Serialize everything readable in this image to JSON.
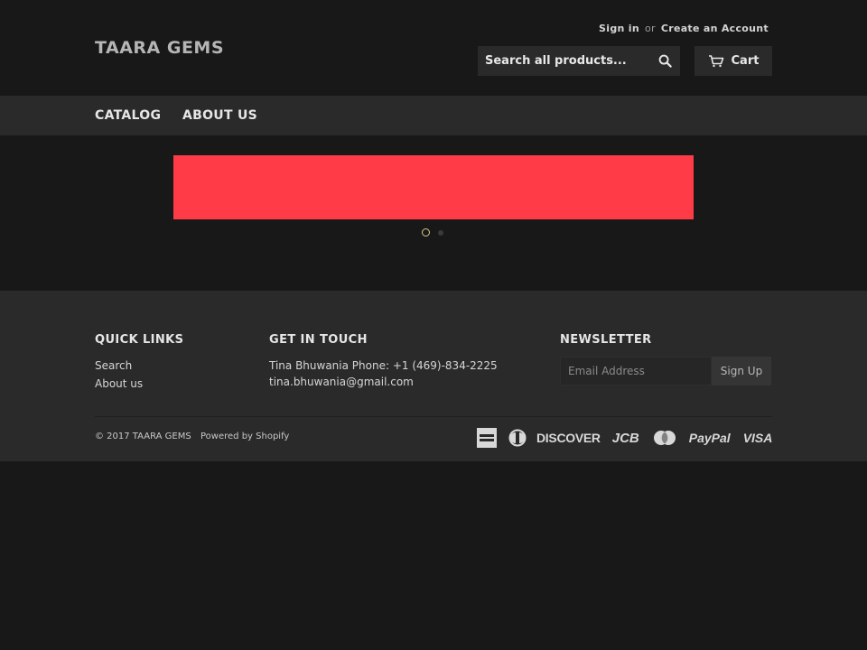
{
  "header": {
    "logo": "TAARA GEMS",
    "sign_in": "Sign in",
    "or": "or",
    "create_account": "Create an Account",
    "search_placeholder": "Search all products...",
    "cart_label": "Cart"
  },
  "nav": {
    "items": [
      {
        "label": "CATALOG"
      },
      {
        "label": "ABOUT US"
      }
    ]
  },
  "slideshow": {
    "slide_color": "#ff3b48",
    "active_index": 0,
    "slide_count": 2
  },
  "footer": {
    "quick_links": {
      "heading": "QUICK LINKS",
      "links": [
        "Search",
        "About us"
      ]
    },
    "contact": {
      "heading": "GET IN TOUCH",
      "line1": "Tina Bhuwania Phone: +1 (469)-834-2225",
      "line2": "tina.bhuwania@gmail.com"
    },
    "newsletter": {
      "heading": "NEWSLETTER",
      "email_placeholder": "Email Address",
      "button": "Sign Up"
    },
    "copyright": "© 2017 TAARA GEMS",
    "powered_by": "Powered by Shopify",
    "payment_methods": [
      "american-express",
      "diners-club",
      "DISCOVER",
      "JCB",
      "master",
      "PayPal",
      "VISA"
    ]
  },
  "colors": {
    "background": "#181818",
    "panel": "#2a2a2a",
    "accent_dot": "#d8c98a"
  }
}
